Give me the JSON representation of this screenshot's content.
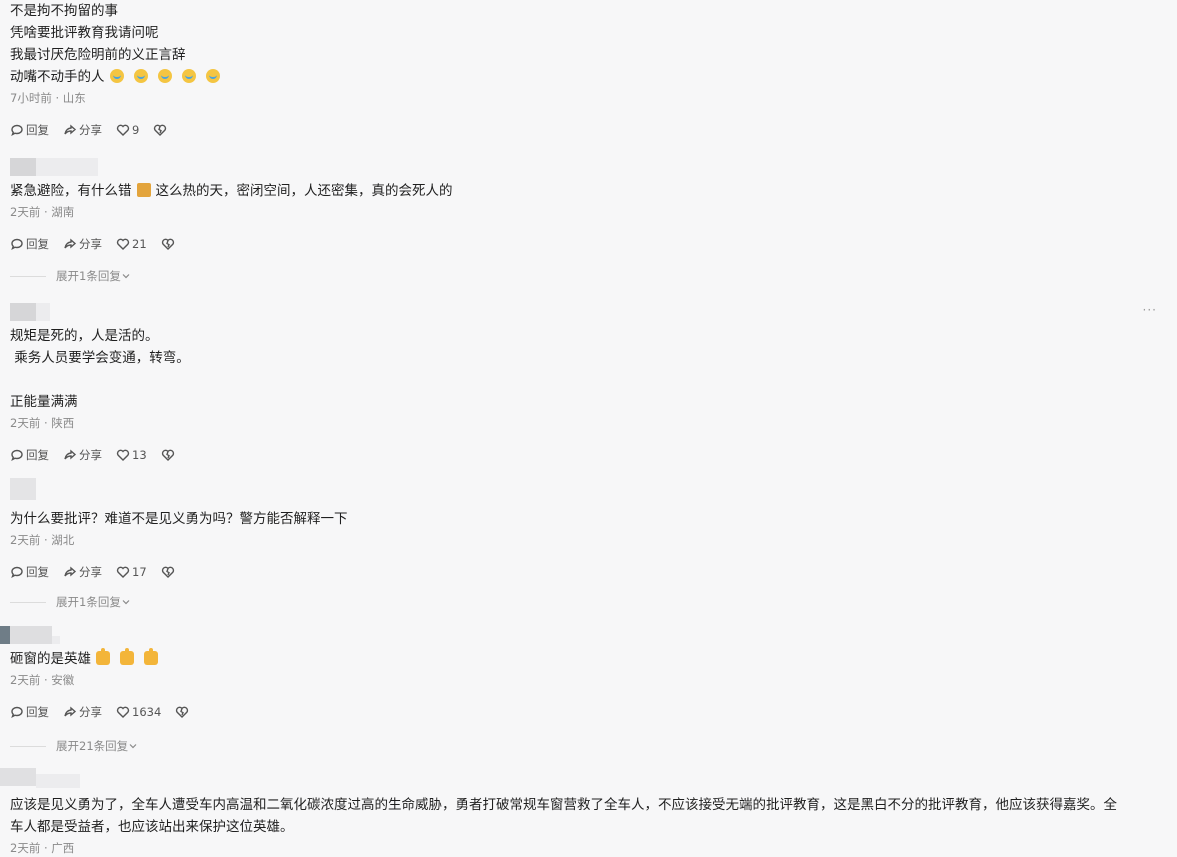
{
  "comments": [
    {
      "lines": [
        "不是拘不拘留的事",
        "凭啥要批评教育我请问呢",
        "我最讨厌危险明前的义正言辞",
        "动嘴不动手的人"
      ],
      "meta": "7小时前 · 山东",
      "reply_label": "回复",
      "share_label": "分享",
      "likes": "9"
    },
    {
      "lines": [
        "紧急避险，有什么错",
        "这么热的天，密闭空间，人还密集，真的会死人的"
      ],
      "meta": "2天前 · 湖南",
      "reply_label": "回复",
      "share_label": "分享",
      "likes": "21",
      "expand": "展开1条回复"
    },
    {
      "lines": [
        "规矩是死的，人是活的。",
        " 乘务人员要学会变通，转弯。",
        "",
        "正能量满满"
      ],
      "meta": "2天前 · 陕西",
      "reply_label": "回复",
      "share_label": "分享",
      "likes": "13"
    },
    {
      "lines": [
        "为什么要批评？难道不是见义勇为吗？警方能否解释一下"
      ],
      "meta": "2天前 · 湖北",
      "reply_label": "回复",
      "share_label": "分享",
      "likes": "17",
      "expand": "展开1条回复"
    },
    {
      "lines": [
        "砸窗的是英雄"
      ],
      "meta": "2天前 · 安徽",
      "reply_label": "回复",
      "share_label": "分享",
      "likes": "1634",
      "expand": "展开21条回复"
    },
    {
      "lines": [
        "应该是见义勇为了，全车人遭受车内高温和二氧化碳浓度过高的生命威胁，勇者打破常规车窗营救了全车人，不应该接受无端的批评教育，这是黑白不分的批评教育，他应该获得嘉奖。全",
        "车人都是受益者，也应该站出来保护这位英雄。"
      ],
      "meta": "2天前 · 广西"
    }
  ],
  "more_icon": "more-dots-icon",
  "colors": {
    "background": "#f7f7f8",
    "meta": "#8a8a8a"
  }
}
